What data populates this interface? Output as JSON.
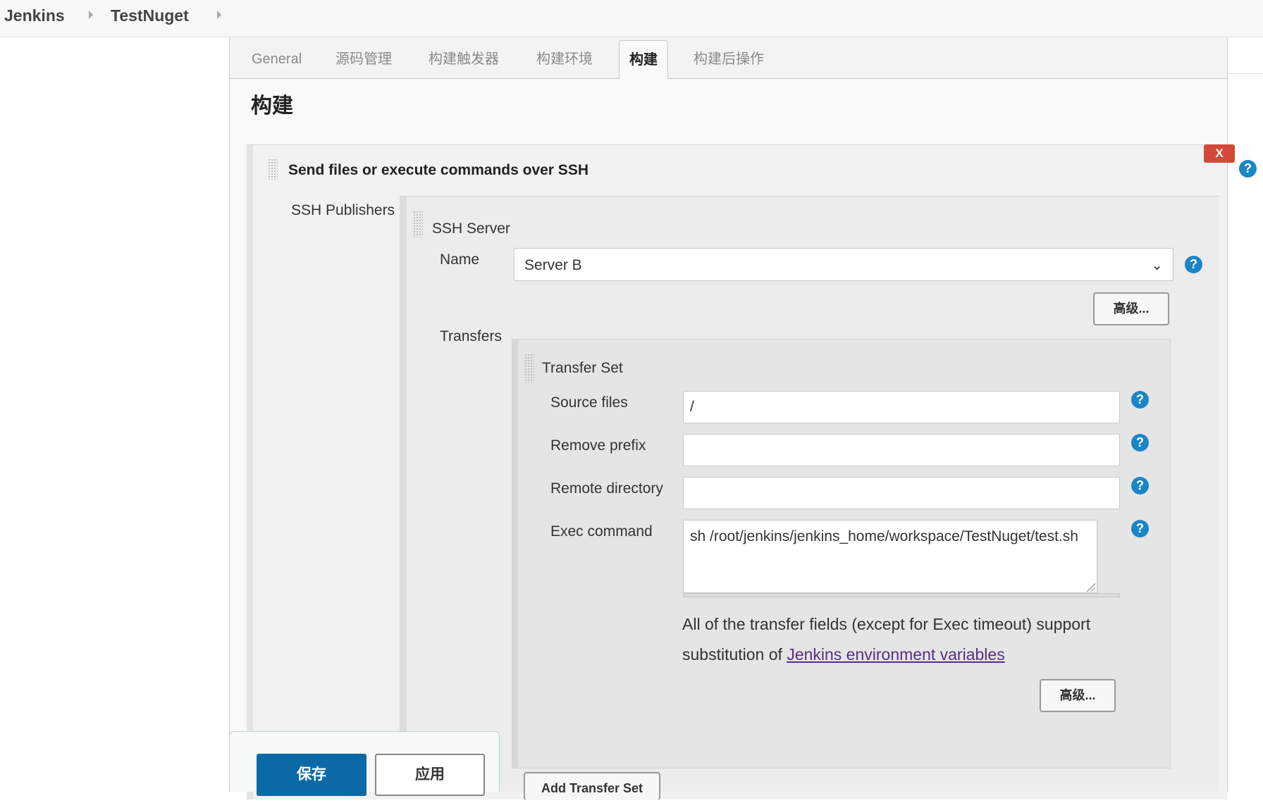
{
  "breadcrumb": {
    "items": [
      "Jenkins",
      "TestNuget"
    ]
  },
  "tabs": {
    "items": [
      "General",
      "源码管理",
      "构建触发器",
      "构建环境",
      "构建",
      "构建后操作"
    ],
    "active": "构建"
  },
  "section": {
    "title": "构建"
  },
  "build_step": {
    "title": "Send files or execute commands over SSH",
    "close_label": "X",
    "publishers_label": "SSH Publishers",
    "server": {
      "title": "SSH Server",
      "name_label": "Name",
      "name_value": "Server B",
      "advanced_label": "高级..."
    },
    "transfers": {
      "label": "Transfers",
      "set_title": "Transfer Set",
      "source_files_label": "Source files",
      "source_files_value": "/",
      "remove_prefix_label": "Remove prefix",
      "remove_prefix_value": "",
      "remote_directory_label": "Remote directory",
      "remote_directory_value": "",
      "exec_command_label": "Exec command",
      "exec_command_value": "sh /root/jenkins/jenkins_home/workspace/TestNuget/test.sh",
      "info_prefix": "All of the transfer fields (except for Exec timeout) support substitution of ",
      "info_link": "Jenkins environment variables",
      "advanced_label": "高级...",
      "add_label": "Add Transfer Set"
    }
  },
  "help_glyph": "?",
  "footer": {
    "save_label": "保存",
    "apply_label": "应用"
  },
  "colors": {
    "save": "#0b6aa6",
    "help": "#1a86c7",
    "close": "#d24939",
    "link": "#5a2f7e"
  }
}
